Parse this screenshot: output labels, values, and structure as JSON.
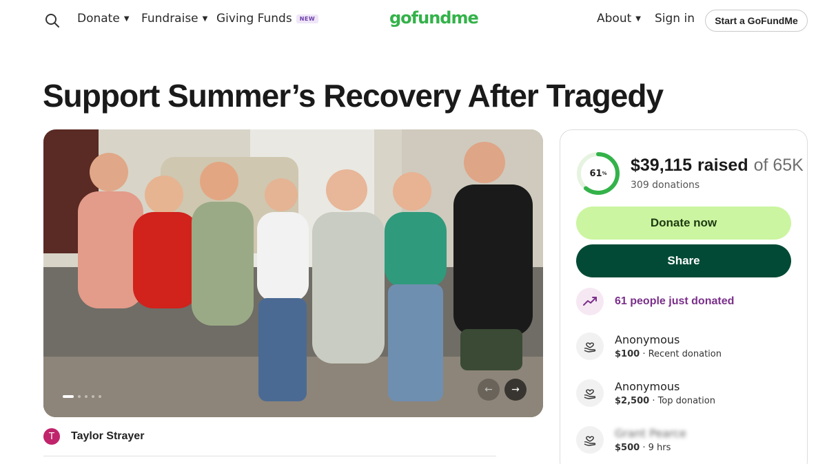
{
  "header": {
    "nav": {
      "donate": "Donate",
      "fundraise": "Fundraise",
      "giving_funds": "Giving Funds",
      "giving_funds_badge": "NEW"
    },
    "logo": "gofundme",
    "about": "About",
    "sign_in": "Sign in",
    "start_cta": "Start a GoFundMe",
    "icons": {
      "search": "search-icon",
      "caret": "caret-down-icon"
    }
  },
  "campaign": {
    "title": "Support Summer’s Recovery After Tragedy",
    "organizer": {
      "initial": "T",
      "name": "Taylor Strayer"
    },
    "carousel": {
      "slide_count": 5,
      "active_slide": 1,
      "prev_icon": "←",
      "next_icon": "→"
    }
  },
  "donation_card": {
    "progress_percent": 61,
    "progress_label": "61",
    "progress_label_unit": "%",
    "raised": "$39,115",
    "raised_word": "raised",
    "goal": "of 65K",
    "donation_count": "309 donations",
    "donate_label": "Donate now",
    "share_label": "Share",
    "trend_text": "61 people just donated",
    "donors": [
      {
        "name": "Anonymous",
        "amount": "$100",
        "detail": "· Recent donation"
      },
      {
        "name": "Anonymous",
        "amount": "$2,500",
        "detail": "· Top donation"
      },
      {
        "name": "Grant Pearce",
        "amount": "$500",
        "detail": "· 9 hrs"
      }
    ]
  },
  "colors": {
    "brand_green": "#34b24a",
    "donate_button": "#cbf5a0",
    "share_button": "#024a35",
    "trend_purple": "#7a2f8a",
    "avatar_pink": "#c0246b"
  }
}
